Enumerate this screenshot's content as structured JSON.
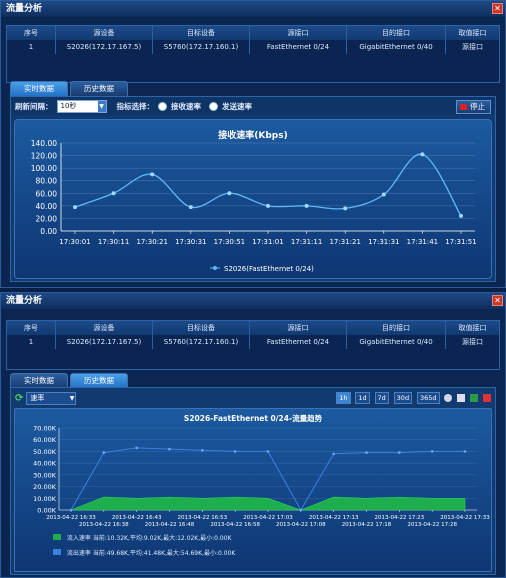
{
  "window1": {
    "title": "流量分析",
    "close_label": "✕",
    "columns": [
      "序号",
      "源设备",
      "目标设备",
      "源接口",
      "目的接口",
      "取值接口"
    ],
    "row": [
      "1",
      "S2026(172.17.167.5)",
      "S5760(172.17.160.1)",
      "FastEthernet 0/24",
      "GigabitEthernet 0/40",
      "源接口"
    ],
    "tabs": [
      "实时数据",
      "历史数据"
    ],
    "toolbar": {
      "refresh_label": "刷新间隔：",
      "refresh_value": "10秒",
      "metric_label": "指标选择：",
      "recv_rate": "接收速率",
      "send_rate": "发送速率",
      "stop_label": "停止"
    }
  },
  "window2": {
    "title": "流量分析",
    "close_label": "✕",
    "columns": [
      "序号",
      "源设备",
      "目标设备",
      "源接口",
      "目的接口",
      "取值接口"
    ],
    "row": [
      "1",
      "S2026(172.17.167.5)",
      "S5760(172.17.160.1)",
      "FastEthernet 0/24",
      "GigabitEthernet 0/40",
      "源接口"
    ],
    "tabs": [
      "实时数据",
      "历史数据"
    ],
    "metric_select": "速率",
    "ranges": [
      "1h",
      "1d",
      "7d",
      "30d",
      "365d"
    ],
    "legend": [
      {
        "text": "流入速率 当前:10.32K,平均:9.02K,最大:12.02K,最小:0.00K",
        "color": "#1fae4d"
      },
      {
        "text": "流出速率 当前:49.68K,平均:41.48K,最大:54.69K,最小:0.00K",
        "color": "#3d7fe0"
      }
    ]
  },
  "colors": {
    "accent": "#4aa0e8",
    "inflow": "#1fae4d",
    "outflow": "#3d7fe0",
    "close": "#c43a2a"
  },
  "chart_data": [
    {
      "type": "line",
      "title": "接收速率(Kbps)",
      "x": [
        "17:30:01",
        "17:30:11",
        "17:30:21",
        "17:30:31",
        "17:30:51",
        "17:31:01",
        "17:31:11",
        "17:31:21",
        "17:31:31",
        "17:31:41",
        "17:31:51"
      ],
      "series": [
        {
          "name": "S2026(FastEthernet 0/24)",
          "values": [
            38,
            60,
            90,
            38,
            60,
            40,
            40,
            36,
            58,
            122,
            24
          ]
        }
      ],
      "ylim": [
        0,
        140
      ],
      "yticks": [
        "140.00",
        "120.00",
        "100.00",
        "80.00",
        "60.00",
        "40.00",
        "20.00",
        "0.00"
      ],
      "legend_position": "bottom"
    },
    {
      "type": "area",
      "title": "S2026-FastEthernet 0/24-流量趋势",
      "x": [
        "2013-04-22 16:33",
        "2013-04-22 16:38",
        "2013-04-22 16:43",
        "2013-04-22 16:48",
        "2013-04-22 16:53",
        "2013-04-22 16:58",
        "2013-04-22 17:03",
        "2013-04-22 17:08",
        "2013-04-22 17:13",
        "2013-04-22 17:18",
        "2013-04-22 17:23",
        "2013-04-22 17:28",
        "2013-04-22 17:33"
      ],
      "series": [
        {
          "name": "流入速率",
          "values": [
            0,
            11,
            10,
            11,
            10,
            11,
            10,
            0,
            11,
            10,
            11,
            10,
            10
          ]
        },
        {
          "name": "流出速率",
          "values": [
            0,
            49,
            53,
            52,
            51,
            50,
            50,
            0,
            48,
            49,
            49,
            50,
            50
          ]
        }
      ],
      "ylim": [
        0,
        70
      ],
      "yticks": [
        "70.00K",
        "60.00K",
        "50.00K",
        "40.00K",
        "30.00K",
        "20.00K",
        "10.00K",
        "0.00K"
      ],
      "legend_position": "bottom-left"
    }
  ]
}
